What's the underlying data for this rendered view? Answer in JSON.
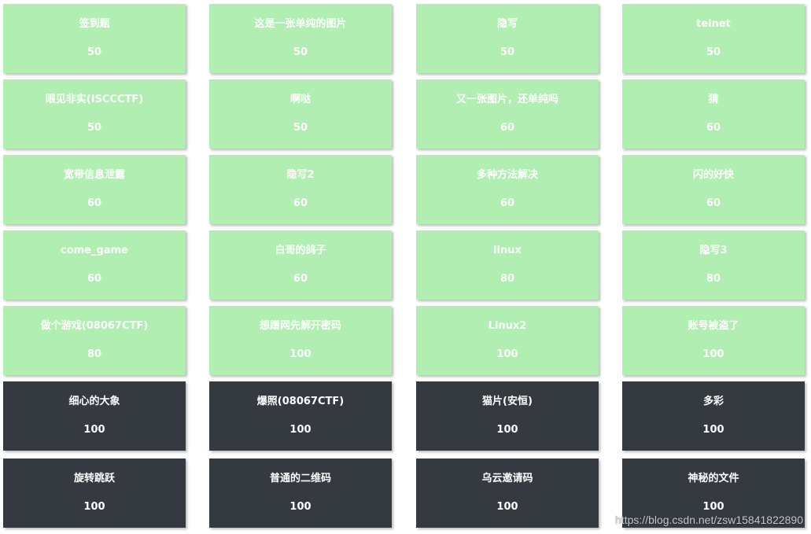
{
  "colors": {
    "solved": "#b0efb1",
    "unsolved": "#343a40",
    "card_text": "#ffffff"
  },
  "challenges": [
    {
      "name": "签到题",
      "points": "50",
      "solved": true
    },
    {
      "name": "这是一张单纯的图片",
      "points": "50",
      "solved": true
    },
    {
      "name": "隐写",
      "points": "50",
      "solved": true
    },
    {
      "name": "telnet",
      "points": "50",
      "solved": true
    },
    {
      "name": "眼见非实(ISCCCTF)",
      "points": "50",
      "solved": true
    },
    {
      "name": "啊哒",
      "points": "50",
      "solved": true
    },
    {
      "name": "又一张图片，还单纯吗",
      "points": "60",
      "solved": true
    },
    {
      "name": "猜",
      "points": "60",
      "solved": true
    },
    {
      "name": "宽带信息泄露",
      "points": "60",
      "solved": true
    },
    {
      "name": "隐写2",
      "points": "60",
      "solved": true
    },
    {
      "name": "多种方法解决",
      "points": "60",
      "solved": true
    },
    {
      "name": "闪的好快",
      "points": "60",
      "solved": true
    },
    {
      "name": "come_game",
      "points": "60",
      "solved": true
    },
    {
      "name": "白哥的鸽子",
      "points": "60",
      "solved": true
    },
    {
      "name": "linux",
      "points": "80",
      "solved": true
    },
    {
      "name": "隐写3",
      "points": "80",
      "solved": true
    },
    {
      "name": "做个游戏(08067CTF)",
      "points": "80",
      "solved": true
    },
    {
      "name": "想蹭网先解开密码",
      "points": "100",
      "solved": true
    },
    {
      "name": "Linux2",
      "points": "100",
      "solved": true
    },
    {
      "name": "账号被盗了",
      "points": "100",
      "solved": true
    },
    {
      "name": "细心的大象",
      "points": "100",
      "solved": false
    },
    {
      "name": "爆照(08067CTF)",
      "points": "100",
      "solved": false
    },
    {
      "name": "猫片(安恒)",
      "points": "100",
      "solved": false
    },
    {
      "name": "多彩",
      "points": "100",
      "solved": false
    },
    {
      "name": "旋转跳跃",
      "points": "100",
      "solved": false
    },
    {
      "name": "普通的二维码",
      "points": "100",
      "solved": false
    },
    {
      "name": "乌云邀请码",
      "points": "100",
      "solved": false
    },
    {
      "name": "神秘的文件",
      "points": "100",
      "solved": false
    }
  ],
  "watermark": "https://blog.csdn.net/zsw15841822890"
}
